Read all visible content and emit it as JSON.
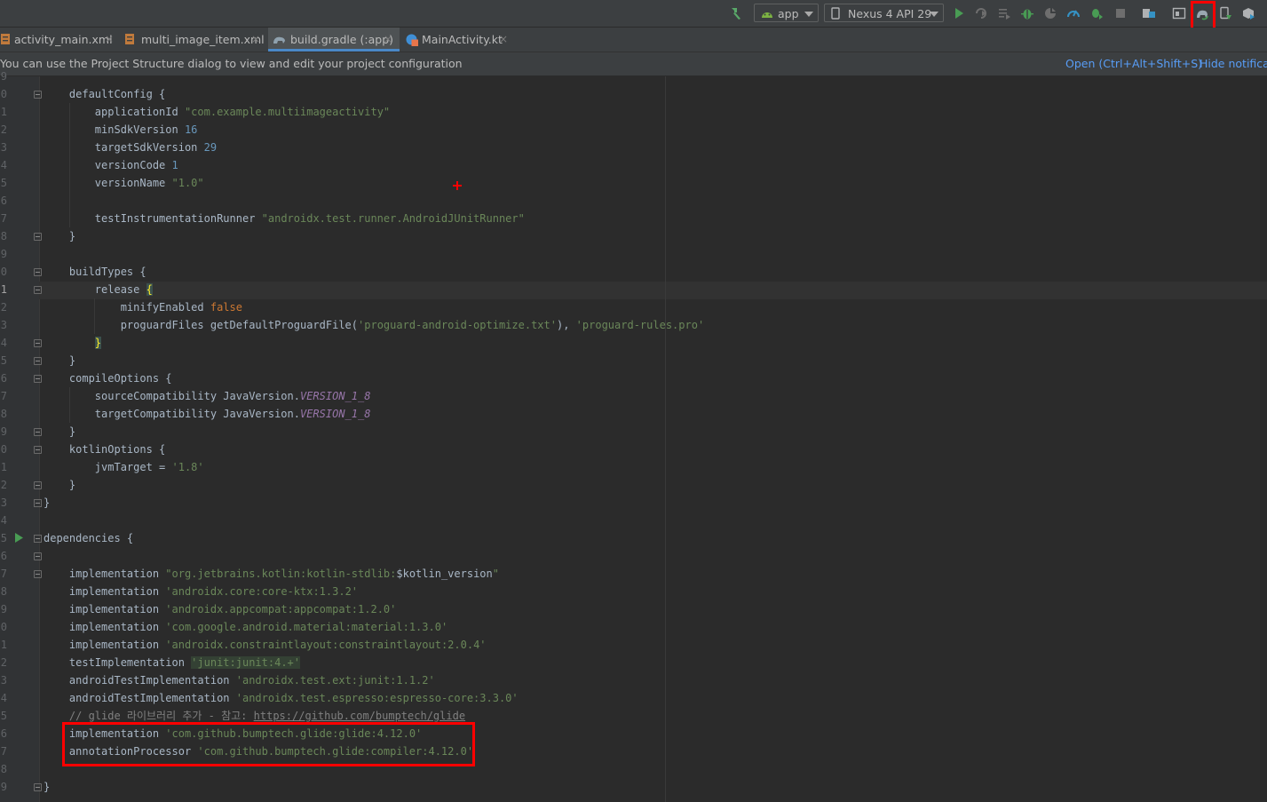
{
  "toolbar": {
    "run_config": "app",
    "device": "Nexus 4 API 29"
  },
  "tabs": [
    {
      "label": "activity_main.xml",
      "icon": "xml-layout-icon"
    },
    {
      "label": "multi_image_item.xml",
      "icon": "xml-layout-icon"
    },
    {
      "label": "build.gradle (:app)",
      "icon": "gradle-icon"
    },
    {
      "label": "MainActivity.kt",
      "icon": "kotlin-file-icon"
    }
  ],
  "tab_close": "×",
  "notification": {
    "message": "You can use the Project Structure dialog to view and edit your project configuration",
    "open_link": "Open (Ctrl+Alt+Shift+S)",
    "hide_link": "Hide notificati"
  },
  "code": {
    "l0": "9",
    "l1n": "0",
    "l1a": "    defaultConfig {",
    "l2n": "1",
    "l2a": "        applicationId ",
    "l2b": "\"com.example.multiimageactivity\"",
    "l3n": "2",
    "l3a": "        minSdkVersion ",
    "l3b": "16",
    "l4n": "3",
    "l4a": "        targetSdkVersion ",
    "l4b": "29",
    "l5n": "4",
    "l5a": "        versionCode ",
    "l5b": "1",
    "l6n": "5",
    "l6a": "        versionName ",
    "l6b": "\"1.0\"",
    "l7n": "6",
    "l8n": "7",
    "l8a": "        testInstrumentationRunner ",
    "l8b": "\"androidx.test.runner.AndroidJUnitRunner\"",
    "l9n": "8",
    "l9a": "    }",
    "l10n": "9",
    "l11n": "0",
    "l11a": "    buildTypes {",
    "l12n": "1",
    "l12a": "        release ",
    "l12b": "{",
    "l13n": "2",
    "l13a": "            minifyEnabled ",
    "l13b": "false",
    "l14n": "3",
    "l14a": "            proguardFiles getDefaultProguardFile(",
    "l14b": "'proguard-android-optimize.txt'",
    "l14c": "), ",
    "l14d": "'proguard-rules.pro'",
    "l15n": "4",
    "l15a": "        ",
    "l15b": "}",
    "l16n": "5",
    "l16a": "    }",
    "l17n": "6",
    "l17a": "    compileOptions {",
    "l18n": "7",
    "l18a": "        sourceCompatibility JavaVersion.",
    "l18b": "VERSION_1_8",
    "l19n": "8",
    "l19a": "        targetCompatibility JavaVersion.",
    "l19b": "VERSION_1_8",
    "l20n": "9",
    "l20a": "    }",
    "l21n": "0",
    "l21a": "    kotlinOptions {",
    "l22n": "1",
    "l22a": "        jvmTarget = ",
    "l22b": "'1.8'",
    "l23n": "2",
    "l23a": "    }",
    "l24n": "3",
    "l24a": "}",
    "l25n": "4",
    "l26n": "5",
    "l26a": "dependencies {",
    "l27n": "6",
    "l28n": "7",
    "l28a": "    implementation ",
    "l28b": "\"org.jetbrains.kotlin:kotlin-stdlib:",
    "l28c": "$kotlin_version",
    "l28d": "\"",
    "l29n": "8",
    "l29a": "    implementation ",
    "l29b": "'androidx.core:core-ktx:1.3.2'",
    "l30n": "9",
    "l30a": "    implementation ",
    "l30b": "'androidx.appcompat:appcompat:1.2.0'",
    "l31n": "0",
    "l31a": "    implementation ",
    "l31b": "'com.google.android.material:material:1.3.0'",
    "l32n": "1",
    "l32a": "    implementation ",
    "l32b": "'androidx.constraintlayout:constraintlayout:2.0.4'",
    "l33n": "2",
    "l33a": "    testImplementation ",
    "l33b": "'junit:junit:4.+'",
    "l34n": "3",
    "l34a": "    androidTestImplementation ",
    "l34b": "'androidx.test.ext:junit:1.1.2'",
    "l35n": "4",
    "l35a": "    androidTestImplementation ",
    "l35b": "'androidx.test.espresso:espresso-core:3.3.0'",
    "l36n": "5",
    "l36a": "    // glide 라이브러리 추가 - 참고: ",
    "l36b": "https://github.com/bumptech/glide",
    "l37n": "6",
    "l37a": "    implementation ",
    "l37b": "'com.github.bumptech.glide:glide:4.12.0'",
    "l38n": "7",
    "l38a": "    annotationProcessor ",
    "l38b": "'com.github.bumptech.glide:compiler:4.12.0'",
    "l39n": "8",
    "l40n": "9",
    "l40a": "}"
  },
  "colors": {
    "highlight_box": "#ff0000",
    "keyword": "#cc7832",
    "string": "#6a8759",
    "number": "#6897bb",
    "link": "#589df6"
  }
}
